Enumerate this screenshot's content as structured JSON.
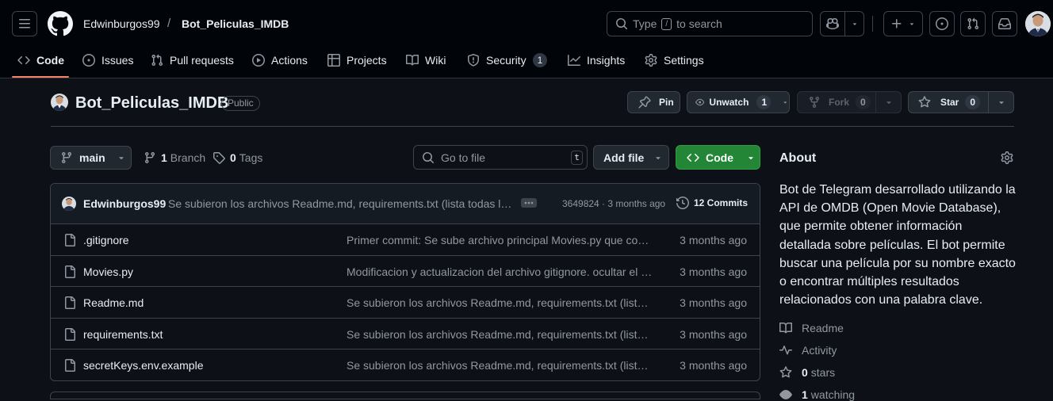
{
  "header": {
    "owner": "Edwinburgos99",
    "separator": "/",
    "repo": "Bot_Peliculas_IMDB",
    "search_type": "Type",
    "search_key": "/",
    "search_rest": "to search"
  },
  "tabs": [
    {
      "label": "Code"
    },
    {
      "label": "Issues"
    },
    {
      "label": "Pull requests"
    },
    {
      "label": "Actions"
    },
    {
      "label": "Projects"
    },
    {
      "label": "Wiki"
    },
    {
      "label": "Security",
      "count": "1"
    },
    {
      "label": "Insights"
    },
    {
      "label": "Settings"
    }
  ],
  "repo": {
    "name": "Bot_Peliculas_IMDB",
    "visibility": "Public",
    "pin_label": "Pin",
    "unwatch_label": "Unwatch",
    "unwatch_count": "1",
    "fork_label": "Fork",
    "fork_count": "0",
    "star_label": "Star",
    "star_count": "0"
  },
  "toolbar": {
    "branch": "main",
    "branch_count": "1",
    "branch_label": "Branch",
    "tag_count": "0",
    "tag_label": "Tags",
    "goto_placeholder": "Go to file",
    "goto_key": "t",
    "add_file": "Add file",
    "code": "Code"
  },
  "commit": {
    "author": "Edwinburgos99",
    "message": "Se subieron los archivos Readme.md, requirements.txt (lista todas las dependencias)",
    "meta": "3649824 · 3 months ago",
    "count_label": "12 Commits"
  },
  "files": [
    {
      "name": ".gitignore",
      "message": "Primer commit: Se sube archivo principal Movies.py que contiene el bot",
      "date": "3 months ago"
    },
    {
      "name": "Movies.py",
      "message": "Modificacion y actualizacion del archivo gitignore. ocultar el token",
      "date": "3 months ago"
    },
    {
      "name": "Readme.md",
      "message": "Se subieron los archivos Readme.md, requirements.txt (lista todas las dependencias)",
      "date": "3 months ago"
    },
    {
      "name": "requirements.txt",
      "message": "Se subieron los archivos Readme.md, requirements.txt (lista todas las dependencias)",
      "date": "3 months ago"
    },
    {
      "name": "secretKeys.env.example",
      "message": "Se subieron los archivos Readme.md, requirements.txt (lista todas las dependencias)",
      "date": "3 months ago"
    }
  ],
  "about": {
    "title": "About",
    "description": "Bot de Telegram desarrollado utilizando la API de OMDB (Open Movie Database), que permite obtener información detallada sobre películas. El bot permite buscar una película por su nombre exacto o encontrar múltiples resultados relacionados con una palabra clave.",
    "readme": "Readme",
    "activity": "Activity",
    "stars_count": "0",
    "stars_label": "stars",
    "watching_count": "1",
    "watching_label": "watching"
  },
  "colors": {
    "accent": "#f78166",
    "primary_button": "#238636",
    "link": "#4493f8"
  }
}
